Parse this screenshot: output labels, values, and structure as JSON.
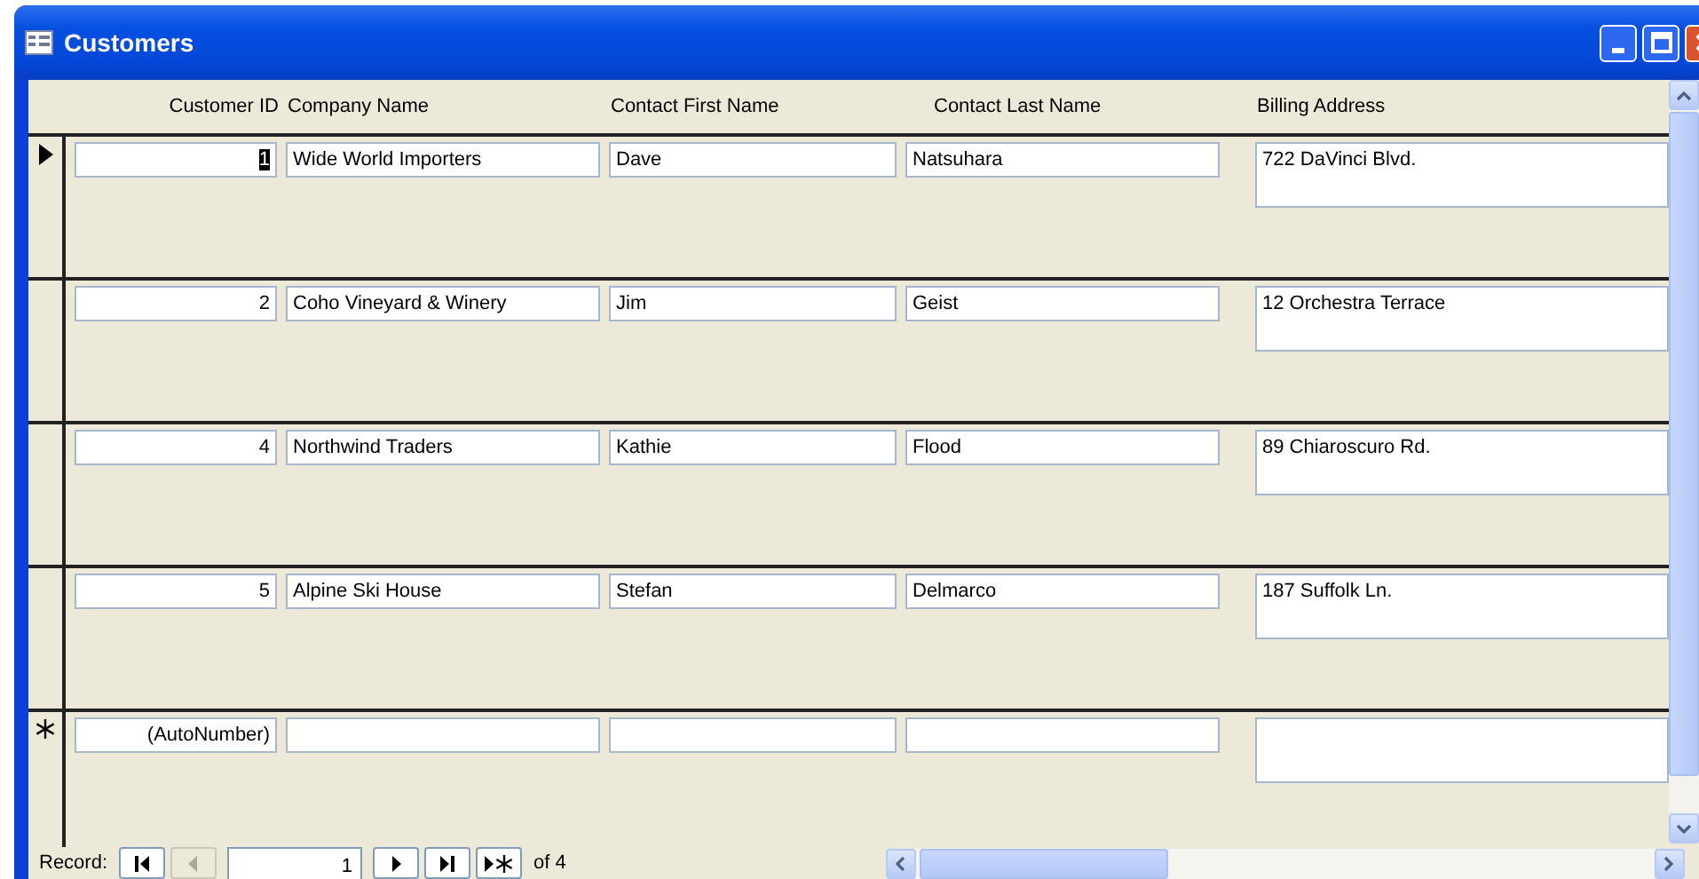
{
  "window": {
    "title": "Customers"
  },
  "columns": [
    "Customer ID",
    "Company Name",
    "Contact First Name",
    "Contact Last Name",
    "Billing Address"
  ],
  "records": [
    {
      "kind": "record",
      "current": true,
      "cells": [
        "1",
        "Wide World Importers",
        "Dave",
        "Natsuhara",
        "722 DaVinci Blvd."
      ]
    },
    {
      "kind": "record",
      "current": false,
      "cells": [
        "2",
        "Coho Vineyard & Winery",
        "Jim",
        "Geist",
        "12 Orchestra Terrace"
      ]
    },
    {
      "kind": "record",
      "current": false,
      "cells": [
        "4",
        "Northwind Traders",
        "Kathie",
        "Flood",
        "89 Chiaroscuro Rd."
      ]
    },
    {
      "kind": "record",
      "current": false,
      "cells": [
        "5",
        "Alpine Ski House",
        "Stefan",
        "Delmarco",
        "187 Suffolk Ln."
      ]
    },
    {
      "kind": "new",
      "current": false,
      "cells": [
        "(AutoNumber)",
        "",
        "",
        "",
        ""
      ]
    }
  ],
  "navigation": {
    "label": "Record:",
    "value": "1",
    "total": "of 4",
    "buttons": [
      {
        "kind": "first",
        "disabled": false
      },
      {
        "kind": "previous",
        "disabled": true
      },
      {
        "kind": "field"
      },
      {
        "kind": "next",
        "disabled": false
      },
      {
        "kind": "last",
        "disabled": false
      },
      {
        "kind": "new",
        "disabled": false
      }
    ]
  }
}
